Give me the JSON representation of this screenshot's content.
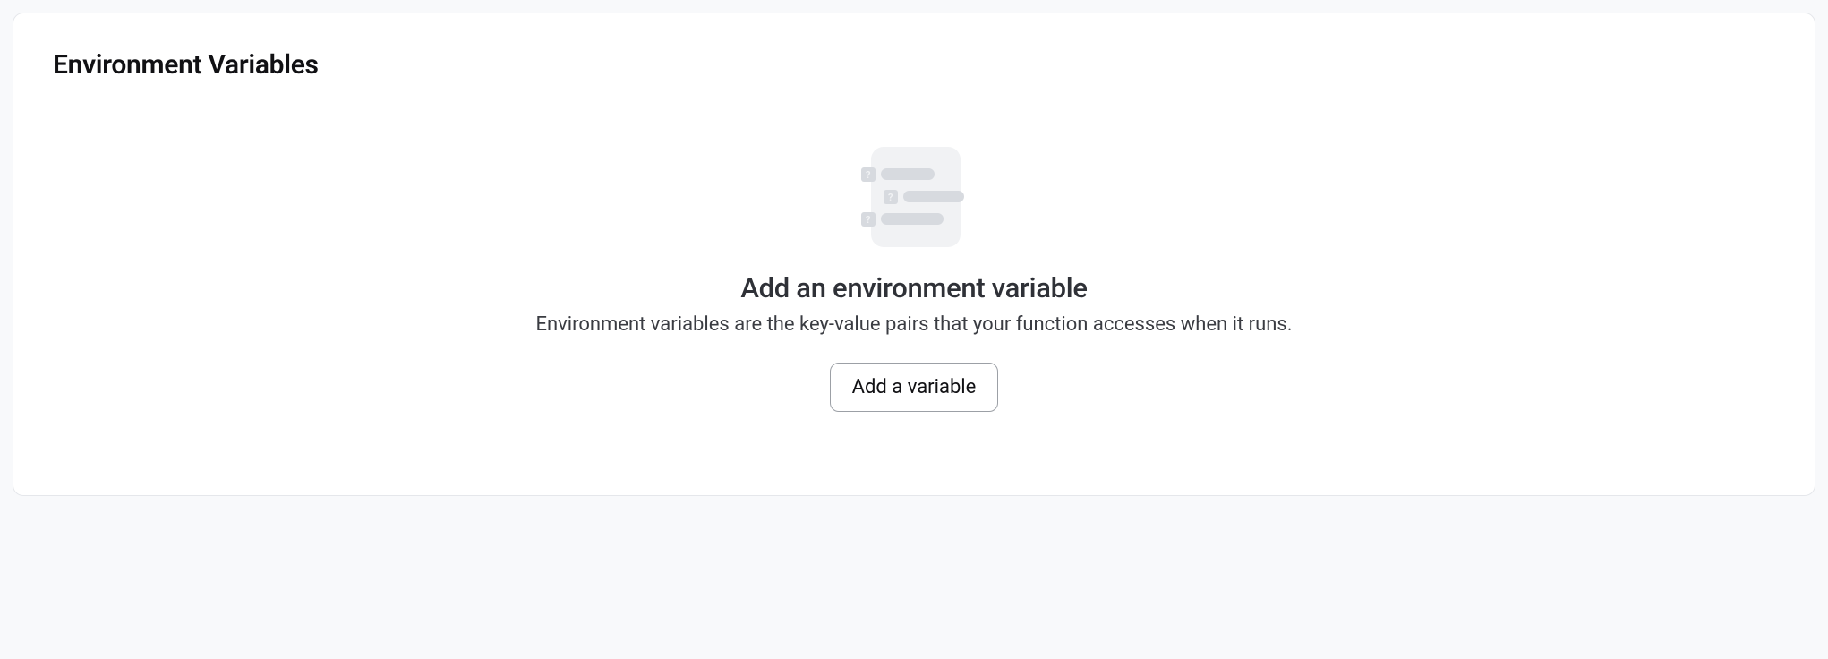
{
  "card": {
    "title": "Environment Variables"
  },
  "empty_state": {
    "title": "Add an environment variable",
    "subtitle": "Environment variables are the key-value pairs that your function accesses when it runs.",
    "button_label": "Add a variable"
  }
}
